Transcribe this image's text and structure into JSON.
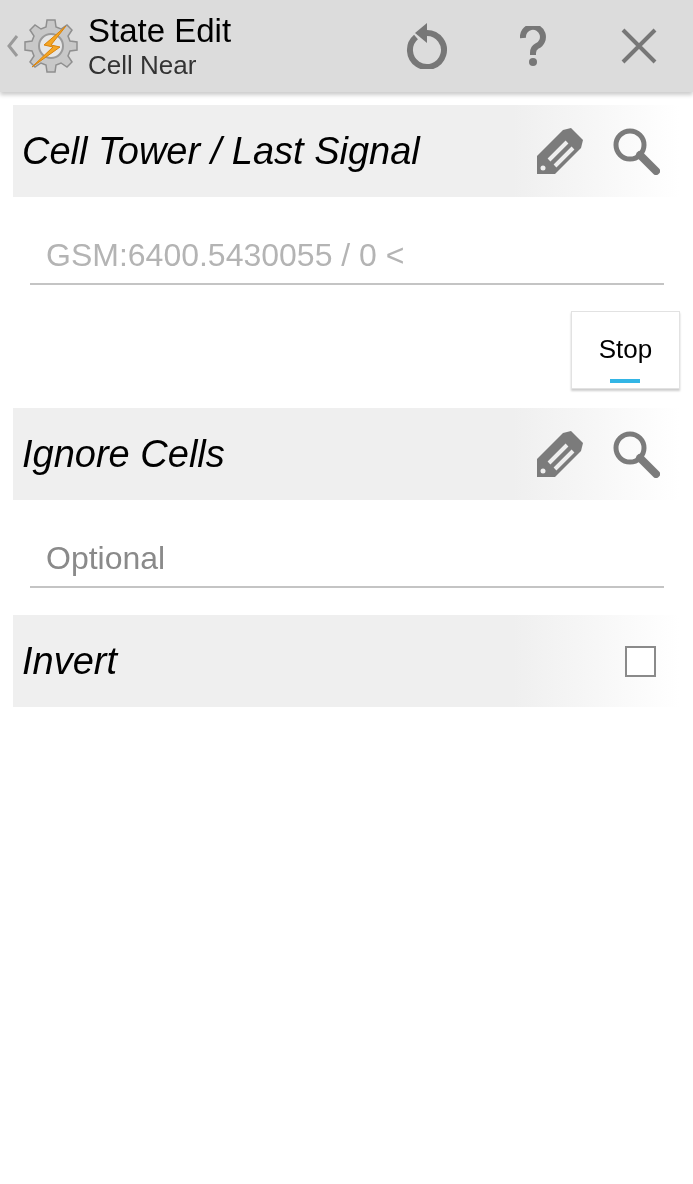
{
  "action_bar": {
    "title": "State Edit",
    "subtitle": "Cell Near"
  },
  "parameters": [
    {
      "kind": "text",
      "label": "Cell Tower / Last Signal",
      "value": "GSM:6400.5430055 / 0 <",
      "button": "Stop"
    },
    {
      "kind": "text",
      "label": "Ignore Cells",
      "placeholder": "Optional"
    },
    {
      "kind": "checkbox",
      "label": "Invert",
      "checked": false
    }
  ]
}
